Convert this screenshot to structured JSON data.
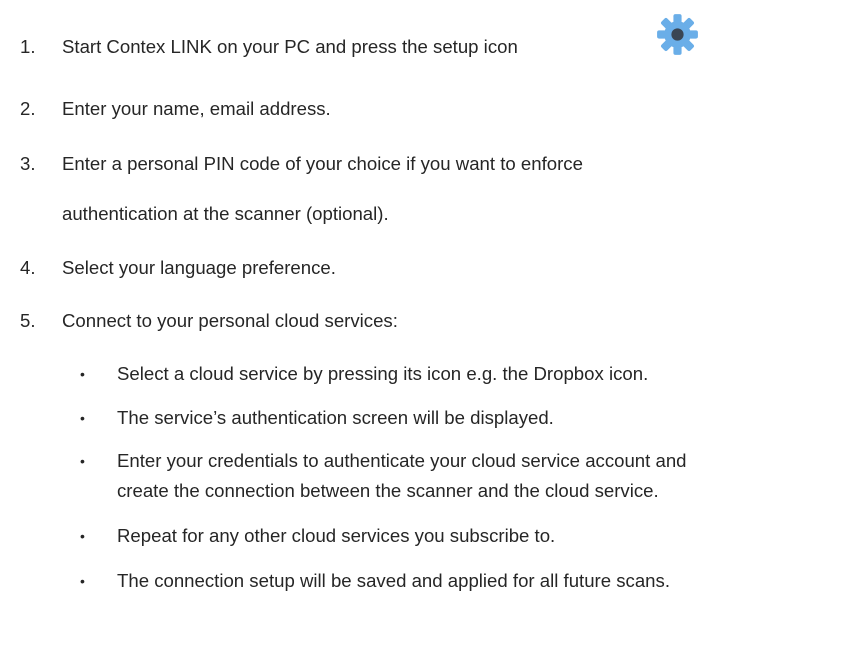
{
  "steps": [
    {
      "num": "1.",
      "text": "Start Contex LINK on your PC and press the setup icon"
    },
    {
      "num": "2.",
      "text": "Enter your name, email address."
    },
    {
      "num": "3.",
      "text": "Enter a personal PIN code of your choice if you want to enforce",
      "text2": "authentication at the scanner (optional)."
    },
    {
      "num": "4.",
      "text": "Select your language preference."
    },
    {
      "num": "5.",
      "text": "Connect to your personal cloud services:"
    }
  ],
  "bullet_symbol": "•",
  "bullets": [
    {
      "text": "Select a cloud service by pressing its icon e.g. the Dropbox icon."
    },
    {
      "text": "The service’s authentication screen will be displayed."
    },
    {
      "text": "Enter your credentials to authenticate your cloud service account and",
      "text2": "create the connection between the scanner and the cloud service."
    },
    {
      "text": "Repeat for any other cloud services you subscribe to."
    },
    {
      "text": "The connection setup will be saved and applied for all future scans."
    }
  ],
  "icons": {
    "setup": "gear-icon",
    "setup_color": "#6aaee8",
    "setup_center_color": "#3a4654"
  }
}
